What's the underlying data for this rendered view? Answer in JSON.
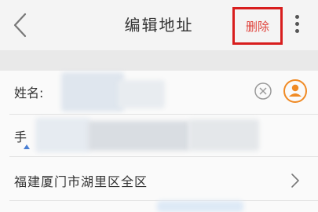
{
  "header": {
    "title": "编辑地址",
    "back_icon": "chevron-left-icon",
    "delete_label": "删除",
    "more_icon": "more-vertical-icon"
  },
  "form": {
    "name_label": "姓名:",
    "phone_prefix": "手",
    "region": "福建厦门市湖里区全区",
    "clear_icon": "clear-circle-icon",
    "contact_icon": "contact-person-icon",
    "region_arrow_icon": "chevron-right-icon"
  },
  "colors": {
    "delete_highlight": "#d81e1e",
    "delete_text": "#e0423a",
    "contact_accent": "#f08a24"
  }
}
